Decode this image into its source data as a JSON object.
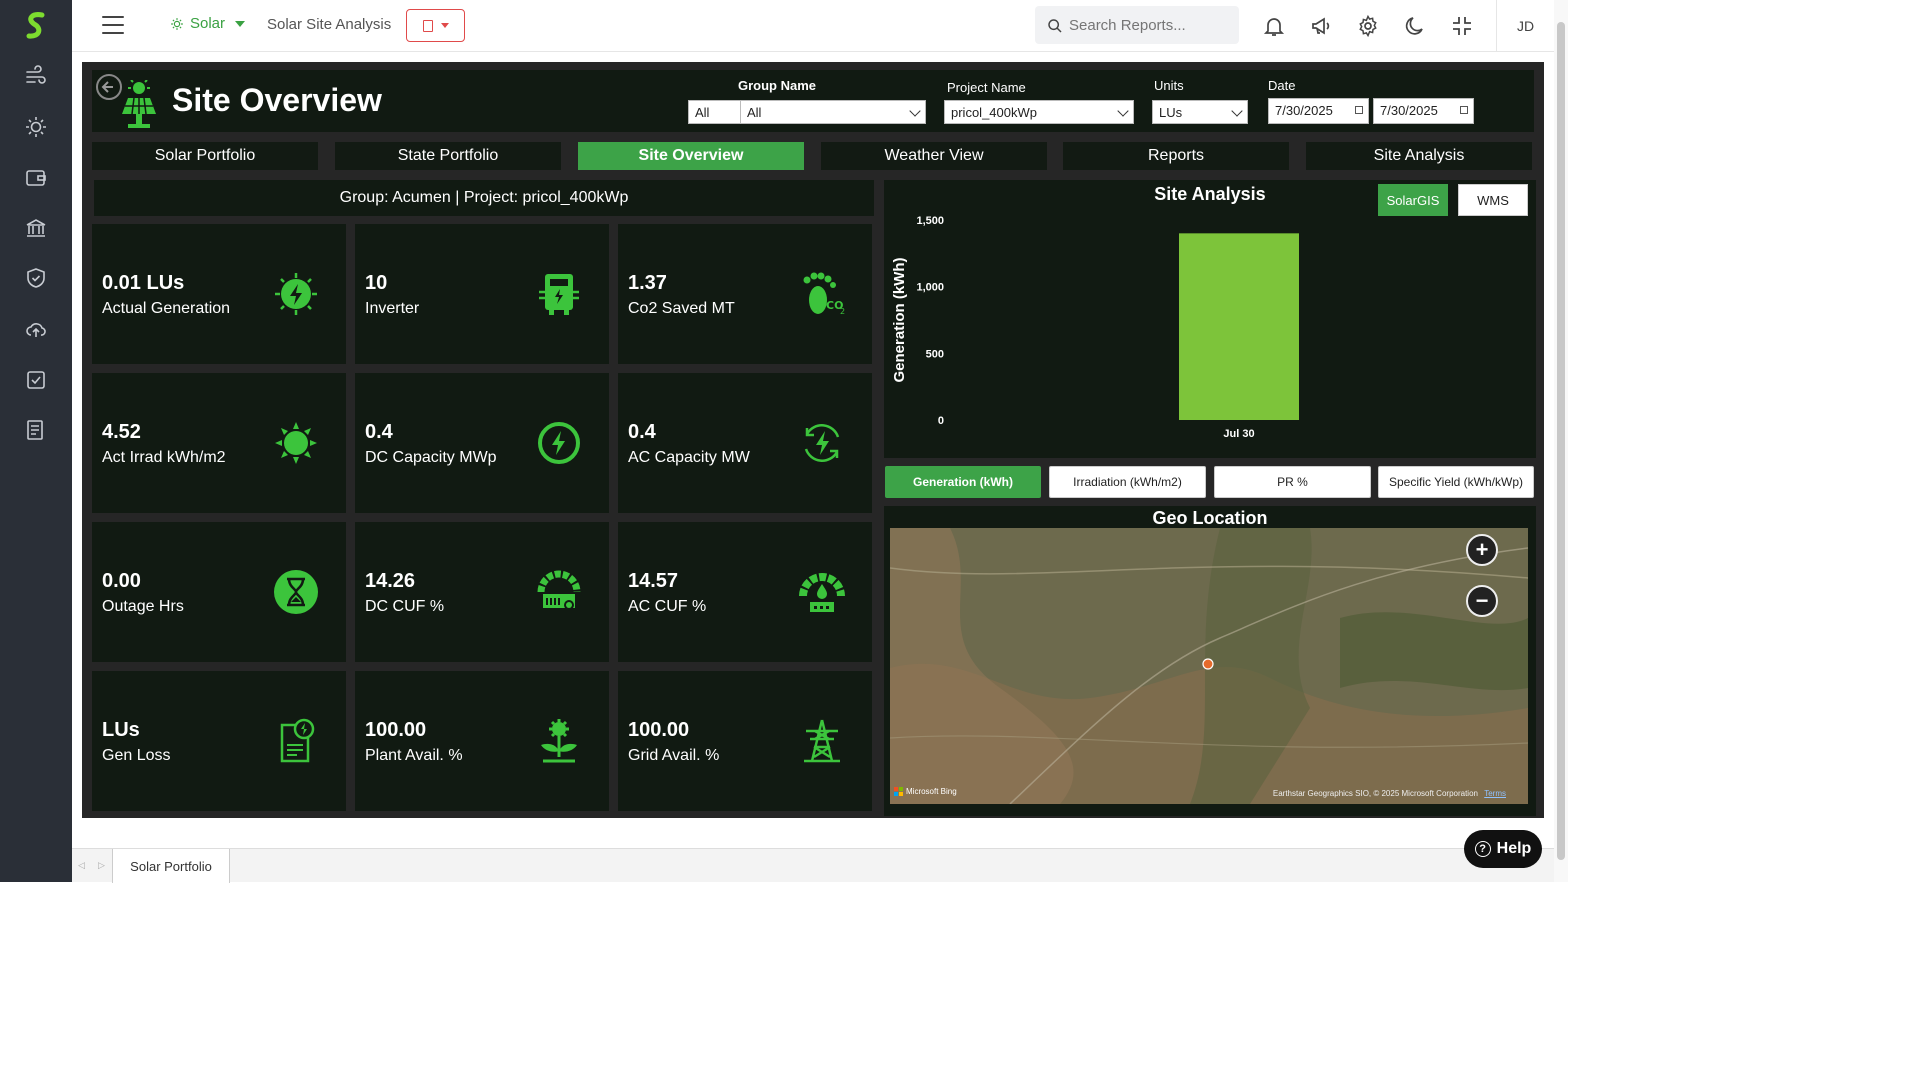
{
  "app": {
    "user_initials": "JD"
  },
  "topbar": {
    "module": "Solar",
    "breadcrumb": "Solar Site Analysis",
    "search_placeholder": "Search Reports..."
  },
  "header": {
    "title": "Site Overview",
    "filters": {
      "group_label": "Group Name",
      "group_value_1": "All",
      "group_value_2": "All",
      "project_label": "Project Name",
      "project_value": "pricol_400kWp",
      "units_label": "Units",
      "units_value": "LUs",
      "date_label": "Date",
      "date_from": "7/30/2025",
      "date_to": "7/30/2025"
    }
  },
  "tabs": [
    {
      "label": "Solar Portfolio"
    },
    {
      "label": "State Portfolio"
    },
    {
      "label": "Site Overview"
    },
    {
      "label": "Weather View"
    },
    {
      "label": "Reports"
    },
    {
      "label": "Site Analysis"
    }
  ],
  "group_bar": "Group: Acumen | Project: pricol_400kWp",
  "cards": [
    {
      "value": "0.01 LUs",
      "label": "Actual Generation",
      "icon": "lightning-sun-icon"
    },
    {
      "value": "10",
      "label": "Inverter",
      "icon": "inverter-icon"
    },
    {
      "value": "1.37",
      "label": "Co2 Saved MT",
      "icon": "co2-footprint-icon"
    },
    {
      "value": "4.52",
      "label": "Act Irrad kWh/m2",
      "icon": "sun-icon"
    },
    {
      "value": "0.4",
      "label": "DC Capacity MWp",
      "icon": "power-circle-icon"
    },
    {
      "value": "0.4",
      "label": "AC Capacity MW",
      "icon": "ac-cycle-icon"
    },
    {
      "value": "0.00",
      "label": "Outage Hrs",
      "icon": "hourglass-icon"
    },
    {
      "value": "14.26",
      "label": "DC CUF %",
      "icon": "dc-gauge-icon"
    },
    {
      "value": "14.57",
      "label": "AC CUF %",
      "icon": "ac-gauge-icon"
    },
    {
      "value": "LUs",
      "label": "Gen Loss",
      "icon": "gen-loss-doc-icon"
    },
    {
      "value": "100.00",
      "label": "Plant Avail. %",
      "icon": "plant-gear-icon"
    },
    {
      "value": "100.00",
      "label": "Grid Avail. %",
      "icon": "transmission-tower-icon"
    }
  ],
  "chart_panel": {
    "title": "Site Analysis",
    "source_buttons": [
      "SolarGIS",
      "WMS"
    ],
    "metric_buttons": [
      "Generation (kWh)",
      "Irradiation (kWh/m2)",
      "PR %",
      "Specific Yield (kWh/kWp)"
    ]
  },
  "chart_data": {
    "type": "bar",
    "categories": [
      "Jul 30"
    ],
    "values": [
      1400
    ],
    "ylabel": "Generation (kWh)",
    "yticks": [
      "0",
      "500",
      "1,000",
      "1,500"
    ],
    "ylim": [
      0,
      1500
    ],
    "bar_color": "#7dc43a"
  },
  "geo": {
    "title": "Geo Location",
    "attribution_left": "Microsoft Bing",
    "attribution_right": "Earthstar Geographics SIO, © 2025 Microsoft Corporation",
    "terms": "Terms"
  },
  "bottom": {
    "tab": "Solar Portfolio",
    "help": "Help"
  },
  "colors": {
    "accent": "#3da348",
    "panel": "#111a12",
    "frame": "#262626",
    "icon_green": "#3cc43c"
  }
}
